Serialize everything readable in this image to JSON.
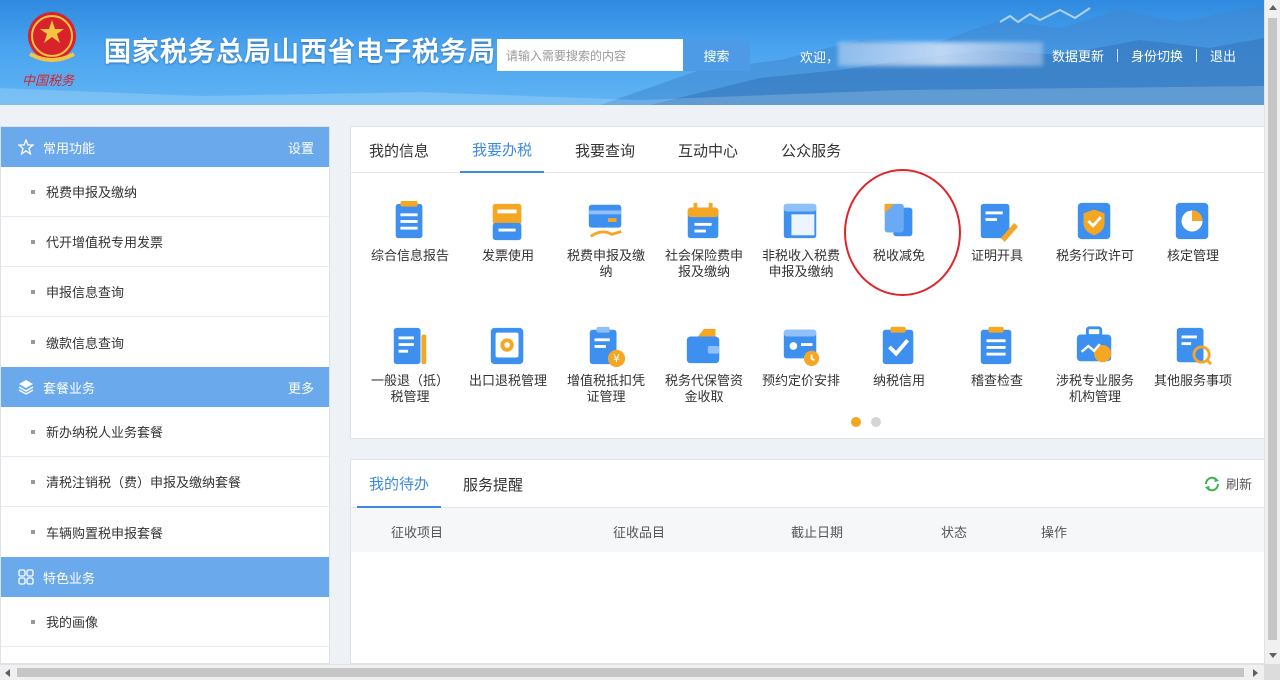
{
  "header": {
    "site_title": "国家税务总局山西省电子税务局",
    "emblem_caption": "中国税务",
    "search_placeholder": "请输入需要搜索的内容",
    "search_button": "搜索",
    "welcome": "欢迎，",
    "links": [
      "数据更新",
      "身份切换",
      "退出"
    ]
  },
  "sidebar": {
    "sections": [
      {
        "title": "常用功能",
        "action": "设置",
        "icon": "star-icon",
        "items": [
          "税费申报及缴纳",
          "代开增值税专用发票",
          "申报信息查询",
          "缴款信息查询"
        ]
      },
      {
        "title": "套餐业务",
        "action": "更多",
        "icon": "layers-icon",
        "items": [
          "新办纳税人业务套餐",
          "清税注销税（费）申报及缴纳套餐",
          "车辆购置税申报套餐"
        ]
      },
      {
        "title": "特色业务",
        "action": "",
        "icon": "grid-icon",
        "items": [
          "我的画像"
        ]
      }
    ]
  },
  "main": {
    "tabs": [
      "我的信息",
      "我要办税",
      "我要查询",
      "互动中心",
      "公众服务"
    ],
    "active_tab": "我要办税",
    "services": [
      {
        "label": "综合信息报告",
        "icon": "report-icon"
      },
      {
        "label": "发票使用",
        "icon": "invoice-icon"
      },
      {
        "label": "税费申报及缴纳",
        "icon": "card-payment-icon"
      },
      {
        "label": "社会保险费申报及缴纳",
        "icon": "calendar-icon"
      },
      {
        "label": "非税收入税费申报及缴纳",
        "icon": "layout-icon"
      },
      {
        "label": "税收减免",
        "icon": "documents-icon"
      },
      {
        "label": "证明开具",
        "icon": "certificate-edit-icon"
      },
      {
        "label": "税务行政许可",
        "icon": "shield-icon"
      },
      {
        "label": "核定管理",
        "icon": "pie-chart-icon"
      },
      {
        "label": "一般退（抵）税管理",
        "icon": "refund-doc-icon"
      },
      {
        "label": "出口退税管理",
        "icon": "gear-doc-icon"
      },
      {
        "label": "增值税抵扣凭证管理",
        "icon": "yen-clipboard-icon"
      },
      {
        "label": "税务代保管资金收取",
        "icon": "wallet-icon"
      },
      {
        "label": "预约定价安排",
        "icon": "id-clock-icon"
      },
      {
        "label": "纳税信用",
        "icon": "check-clipboard-icon"
      },
      {
        "label": "稽查检查",
        "icon": "list-clipboard-icon"
      },
      {
        "label": "涉税专业服务机构管理",
        "icon": "briefcase-chart-icon"
      },
      {
        "label": "其他服务事项",
        "icon": "search-doc-icon"
      }
    ],
    "page_dots": 2,
    "active_dot": 0
  },
  "todo": {
    "tabs": [
      "我的待办",
      "服务提醒"
    ],
    "refresh": "刷新",
    "columns": [
      "征收项目",
      "征收品目",
      "截止日期",
      "状态",
      "操作"
    ]
  },
  "colors": {
    "accent": "#3c8ae0",
    "sidebar_header": "#6aa9ec",
    "icon_blue": "#3d8ff0",
    "icon_orange": "#f5a623",
    "highlight": "#e0242a"
  }
}
